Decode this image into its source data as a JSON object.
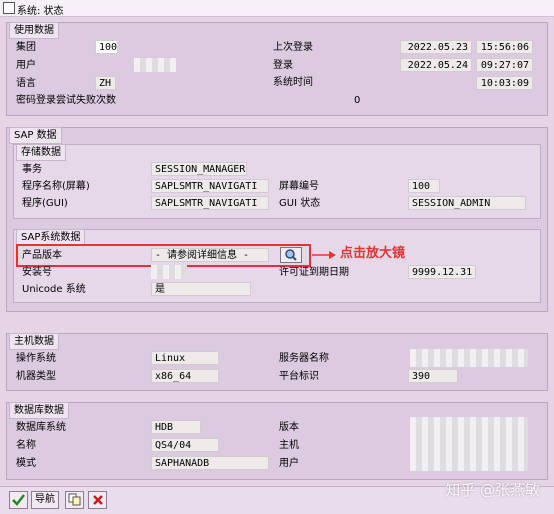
{
  "title": "系统: 状态",
  "usage": {
    "header": "使用数据",
    "client_label": "集团",
    "client_value": "100",
    "user_label": "用户",
    "language_label": "语言",
    "language_value": "ZH",
    "failed_logon_label": "密码登录尝试失败次数",
    "failed_logon_value": "0",
    "last_logon_label": "上次登录",
    "last_logon_date": "2022.05.23",
    "last_logon_time": "15:56:06",
    "logon_label": "登录",
    "logon_date": "2022.05.24",
    "logon_time": "09:27:07",
    "system_time_label": "系统时间",
    "system_time_value": "10:03:09"
  },
  "sap": {
    "header": "SAP 数据",
    "repo_header": "存储数据",
    "transaction_label": "事务",
    "transaction_value": "SESSION_MANAGER",
    "program_screen_label": "程序名称(屏幕)",
    "program_screen_value": "SAPLSMTR_NAVIGATI",
    "program_gui_label": "程序(GUI)",
    "program_gui_value": "SAPLSMTR_NAVIGATI",
    "screen_number_label": "屏幕编号",
    "screen_number_value": "100",
    "gui_status_label": "GUI 状态",
    "gui_status_value": "SESSION_ADMIN",
    "system_header": "SAP系统数据",
    "product_version_label": "产品版本",
    "product_version_value": "- 请参阅详细信息 -",
    "install_label": "安装号",
    "license_label": "许可证到期日期",
    "license_value": "9999.12.31",
    "unicode_label": "Unicode 系统",
    "unicode_value": "是",
    "annotation": "点击放大镜"
  },
  "host": {
    "header": "主机数据",
    "os_label": "操作系统",
    "os_value": "Linux",
    "machine_label": "机器类型",
    "machine_value": "x86_64",
    "server_label": "服务器名称",
    "platform_label": "平台标识",
    "platform_value": "390"
  },
  "db": {
    "header": "数据库数据",
    "system_label": "数据库系统",
    "system_value": "HDB",
    "name_label": "名称",
    "name_value": "QS4/04",
    "schema_label": "模式",
    "schema_value": "SAPHANADB",
    "version_label": "版本",
    "host_label": "主机",
    "user_label": "用户"
  },
  "toolbar": {
    "nav_label": "导航"
  },
  "watermark": "知乎 @张燕敏",
  "colors": {
    "annotation": "#e63232",
    "background": "#e4d4e6"
  }
}
